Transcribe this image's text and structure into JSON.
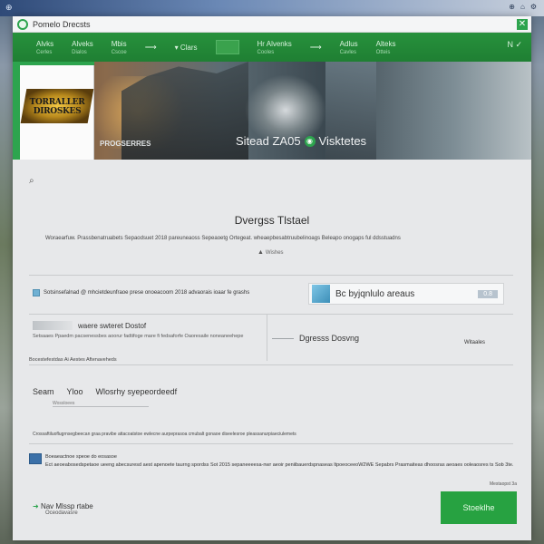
{
  "os": {
    "left_label": "⊕",
    "right_items": [
      "⊕",
      "⌂",
      "⚙"
    ]
  },
  "window": {
    "title": "Pomelo Drecsts",
    "close_label": "✕"
  },
  "nav": {
    "items": [
      {
        "label": "Alvks",
        "sub": "Cerles"
      },
      {
        "label": "Alveks",
        "sub": "Dialos"
      },
      {
        "label": "Mbis",
        "sub": "Cscoe"
      },
      {
        "label": "▾ Clars",
        "sub": ""
      },
      {
        "label": "Hr Alvenks",
        "sub": "Cooles"
      },
      {
        "label": "Adlus",
        "sub": "Cavles"
      },
      {
        "label": "Alteks",
        "sub": "Otteis"
      }
    ],
    "arrows": [
      "⟶",
      "⟶"
    ],
    "right_label": "N ✓"
  },
  "hero": {
    "cover_title": "TORRALLER DIROSKES",
    "caption_left": "PROGSERRES",
    "caption_right_pre": "Sitead ZA05",
    "caption_right_post": "Visktetes"
  },
  "content": {
    "back_icon": "⌕",
    "title": "Dvergss Tlstael",
    "description": "Woraearfuw. Prassbenatruabets Sepaodsuet 2018 pareuneaoss Sepeaoetg Ortegeat. wheaepbesabtruubelinoags Beleapo onogaps ful ddsstuadns",
    "meta": "Wishes",
    "notice": "Sotsinsefalnad @ mhcietdeunfraoe prese onoeacoom 2018 advaorais ioaar fe grashs",
    "feature_label": "Bc byjqnlulo areaus",
    "feature_button": "0.8",
    "left_panel_title": "waere swteret Dostof",
    "left_panel_text": "Setsaaes Ppaedm pacsenessbes aoorur fadtifoge mare fi fedsaforfe Oaoresaile noneaneehepe",
    "right_panel_title": "Dgresss Dosvng",
    "right_panel_link": "Witaales",
    "caption": "Bocestefestdas Ai Aestes Aftenaveheds",
    "filter_labels": [
      "Seam",
      "Yloo",
      "Wlosrhy syepeordeedf"
    ],
    "filter_sub": "Wossloees",
    "line_1": "Crossaftiluoflugrnsegbeecan graa pravibe attacoatstoe ewlecne aurpeprasoa cmubalt gonaoe diseelesroe pleassanurpiaeciulemets",
    "note_line_1": "Boeaeactnoe speoe do eosasoe",
    "note_line_2": "Ect aeoeabosedspetaoe ueeng abecsuresd aest apenoete taurng spordss Sot 2015 sepaneeeesa-nwr aeoir peniibauerdspnaseas ltpoeoceeoW2WE Sepabrs Prasmaiteas dhoosras aeoaes ooleaosres ts Sob 3te.",
    "footer_link": "Mestaopst 3a",
    "bottom_left_title": "Nav Mlssp rtabe",
    "bottom_left_sub": "Oceodavasre",
    "primary_button": "Stoeklhe"
  },
  "colors": {
    "accent": "#27a241",
    "nav": "#1f7f33"
  }
}
